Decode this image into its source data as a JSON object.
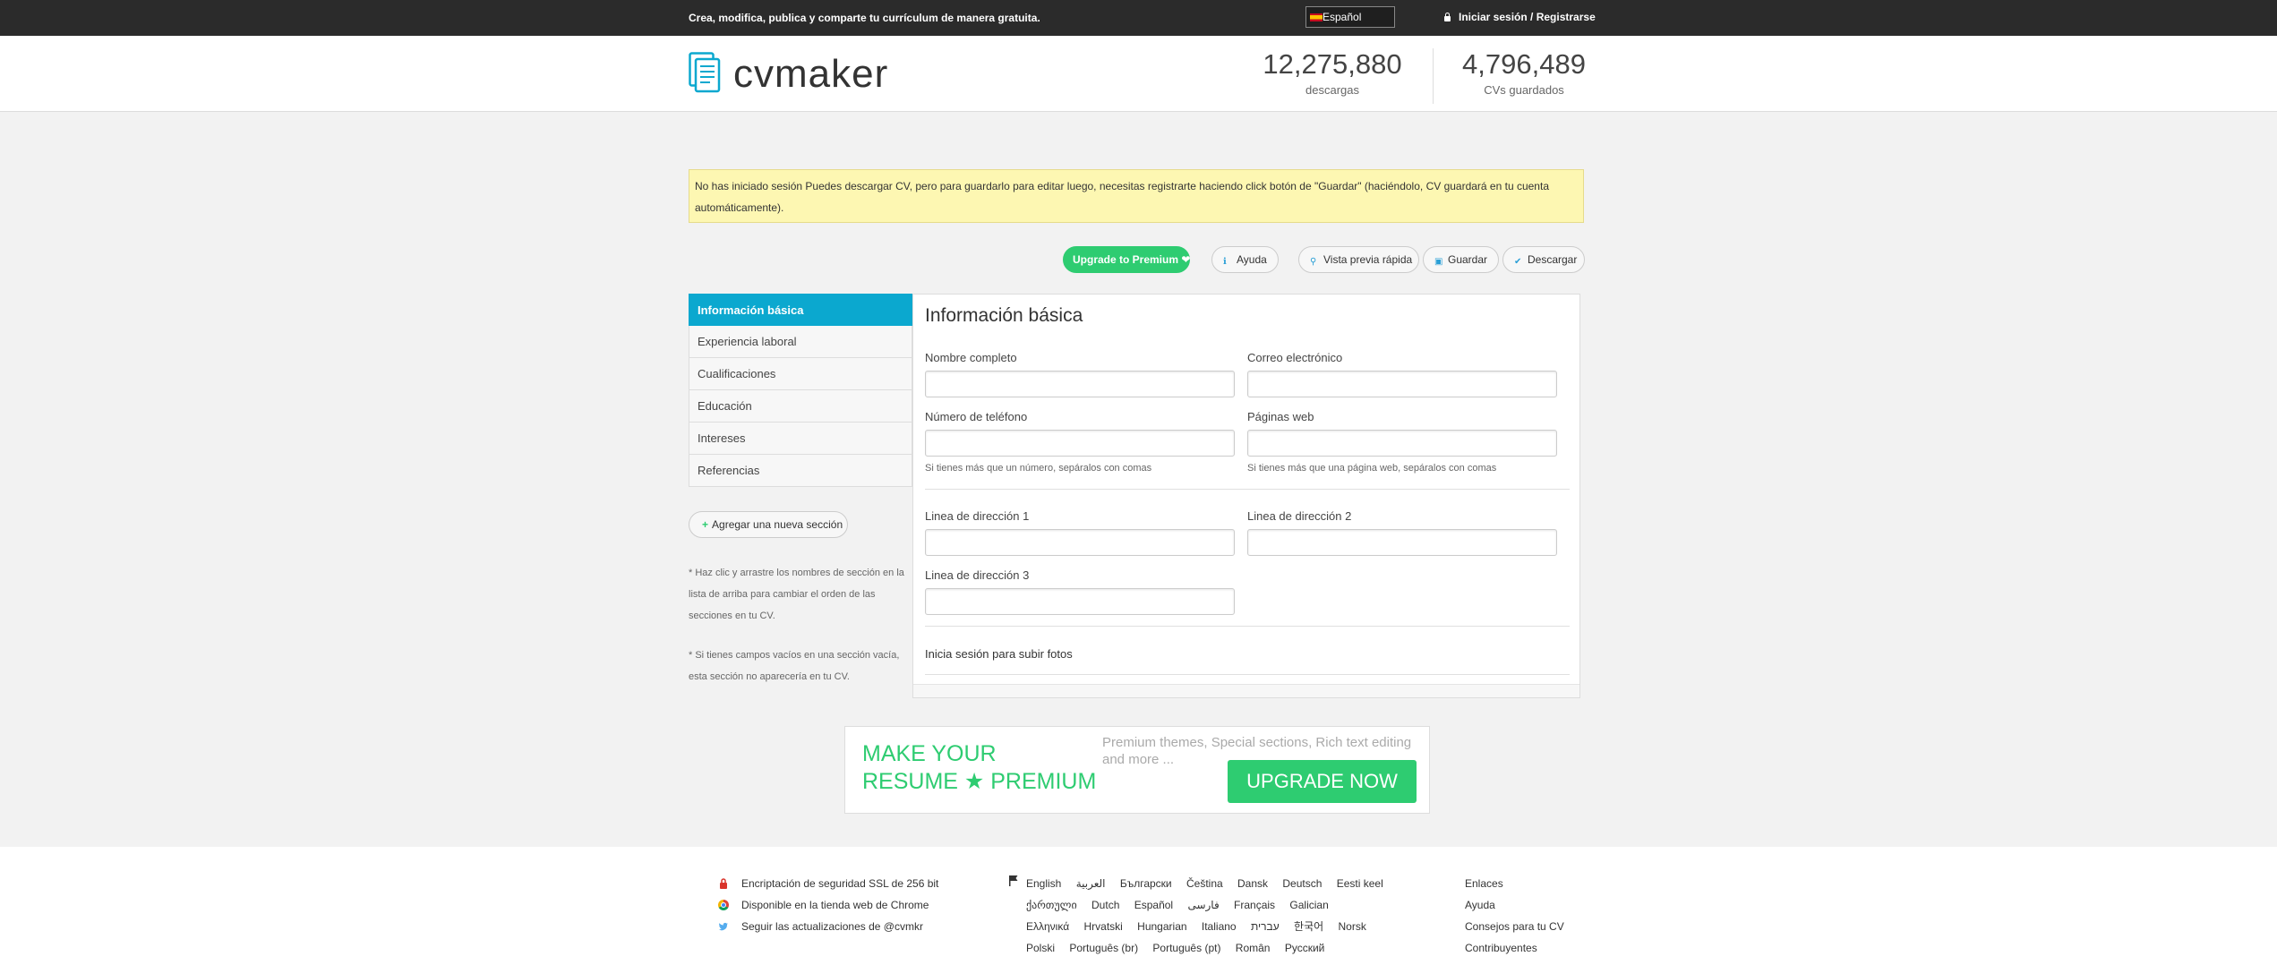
{
  "topbar": {
    "tagline": "Crea, modifica, publica y comparte tu currículum de manera gratuita.",
    "language": "Español",
    "login": "Iniciar sesión / Registrarse"
  },
  "header": {
    "logo": "cvmaker",
    "stats": [
      {
        "value": "12,275,880",
        "label": "descargas"
      },
      {
        "value": "4,796,489",
        "label": "CVs guardados"
      }
    ]
  },
  "notice": "No has iniciado sesión Puedes descargar CV, pero para guardarlo para editar luego, necesitas registrarte haciendo click botón de \"Guardar\" (haciéndolo, CV guardará en tu cuenta automáticamente).",
  "toolbar": {
    "premium": "Upgrade to Premium ❤",
    "help": "Ayuda",
    "preview": "Vista previa rápida",
    "save": "Guardar",
    "download": "Descargar"
  },
  "sidebar": {
    "items": [
      "Información básica",
      "Experiencia laboral",
      "Cualificaciones",
      "Educación",
      "Intereses",
      "Referencias"
    ],
    "add_section": "Agregar una nueva sección",
    "note1": "* Haz clic y arrastre los nombres de sección en la lista de arriba para cambiar el orden de las secciones en tu CV.",
    "note2": "* Si tienes campos vacíos en una sección vacía, esta sección no aparecería en tu CV."
  },
  "form": {
    "title": "Información básica",
    "full_name": {
      "label": "Nombre completo",
      "value": ""
    },
    "email": {
      "label": "Correo electrónico",
      "value": ""
    },
    "phone": {
      "label": "Número de teléfono",
      "value": "",
      "help": "Si tienes más que un número, sepáralos con comas"
    },
    "web": {
      "label": "Páginas web",
      "value": "",
      "help": "Si tienes más que una página web, sepáralos con comas"
    },
    "address1": {
      "label": "Linea de dirección 1",
      "value": ""
    },
    "address2": {
      "label": "Linea de dirección 2",
      "value": ""
    },
    "address3": {
      "label": "Linea de dirección 3",
      "value": ""
    },
    "photo_link": "Inicia sesión para subir fotos"
  },
  "banner": {
    "line1": "MAKE YOUR",
    "line2": "RESUME ★ PREMIUM",
    "desc": "Premium themes, Special sections, Rich text editing and more ...",
    "button": "UPGRADE NOW"
  },
  "footer": {
    "ssl": "Encriptación de seguridad SSL de 256 bit",
    "chrome": "Disponible en la tienda web de Chrome",
    "twitter": "Seguir las actualizaciones de @cvmkr",
    "languages": [
      [
        "English",
        "العربية",
        "Български",
        "Čeština",
        "Dansk",
        "Deutsch",
        "Eesti keel"
      ],
      [
        "ქართული",
        "Dutch",
        "Español",
        "فارسی",
        "Français",
        "Galician"
      ],
      [
        "Ελληνικά",
        "Hrvatski",
        "Hungarian",
        "Italiano",
        "עברית",
        "한국어",
        "Norsk"
      ],
      [
        "Polski",
        "Português (br)",
        "Português (pt)",
        "Român",
        "Русский"
      ]
    ],
    "links": [
      "Enlaces",
      "Ayuda",
      "Consejos para tu CV",
      "Contribuyentes"
    ]
  },
  "colors": {
    "accent": "#0ba8cf",
    "premium_green": "#2ecc71",
    "notice_bg": "#fdf7b2",
    "topbar": "#2b2b2b"
  }
}
